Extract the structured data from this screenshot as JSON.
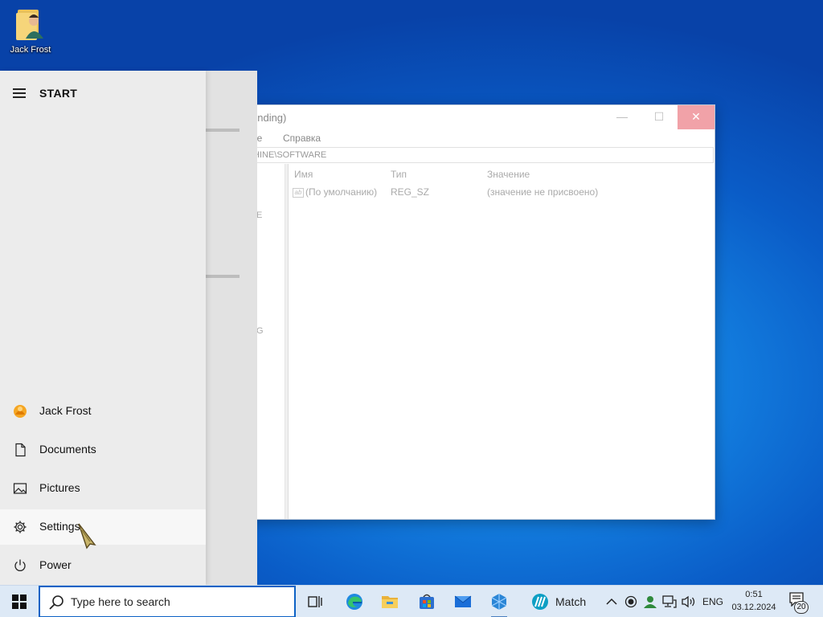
{
  "desktop": {
    "icon_label": "Jack Frost"
  },
  "regedit": {
    "title_fragment": "onding)",
    "menu_fragment": "ое",
    "menu_help": "Справка",
    "address": "HINE\\SOFTWARE",
    "tree_fragments": [
      "E",
      "G"
    ],
    "columns": {
      "name": "Имя",
      "type": "Тип",
      "value": "Значение"
    },
    "rows": [
      {
        "icon": "string-value-icon",
        "name": "(По умолчанию)",
        "type": "REG_SZ",
        "value": "(значение не присвоено)"
      }
    ]
  },
  "start_menu": {
    "title": "START",
    "items": [
      {
        "id": "user",
        "label": "Jack Frost",
        "icon": "user-avatar-icon"
      },
      {
        "id": "documents",
        "label": "Documents",
        "icon": "document-icon"
      },
      {
        "id": "pictures",
        "label": "Pictures",
        "icon": "pictures-icon"
      },
      {
        "id": "settings",
        "label": "Settings",
        "icon": "gear-icon"
      },
      {
        "id": "power",
        "label": "Power",
        "icon": "power-icon"
      }
    ]
  },
  "taskbar": {
    "search_placeholder": "Type here to search",
    "apps": [
      "task-view-icon",
      "edge-icon",
      "file-explorer-icon",
      "store-icon",
      "mail-icon",
      "app-icon"
    ],
    "match_label": "Match",
    "tray": {
      "language": "ENG",
      "time": "0:51",
      "date": "03.12.2024",
      "notification_count": "20"
    }
  },
  "colors": {
    "accent": "#0c62c5",
    "taskbar": "#dde9f6",
    "start_bg": "#ececec"
  }
}
